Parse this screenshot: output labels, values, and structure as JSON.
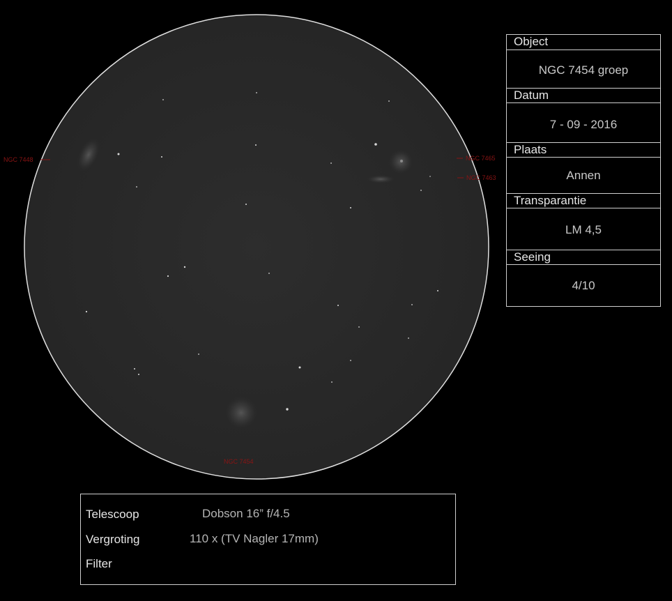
{
  "objects": {
    "ngc7448": "NGC 7448",
    "ngc7465": "NGC 7465",
    "ngc7463": "NGC 7463",
    "ngc7454": "NGC 7454"
  },
  "info": {
    "object_label": "Object",
    "object_value": "NGC 7454 groep",
    "date_label": "Datum",
    "date_value": "7 - 09 - 2016",
    "place_label": "Plaats",
    "place_value": "Annen",
    "transparency_label": "Transparantie",
    "transparency_value": "LM 4,5",
    "seeing_label": "Seeing",
    "seeing_value": "4/10"
  },
  "equipment": {
    "telescope_label": "Telescoop",
    "telescope_value": "Dobson 16” f/4.5",
    "magnification_label": "Vergroting",
    "magnification_value": "110 x (TV Nagler 17mm)",
    "filter_label": "Filter",
    "filter_value": ""
  },
  "colors": {
    "background": "#000000",
    "field": "#2a2a2a",
    "annotation": "#8a1414",
    "border": "#cfcfcf"
  }
}
